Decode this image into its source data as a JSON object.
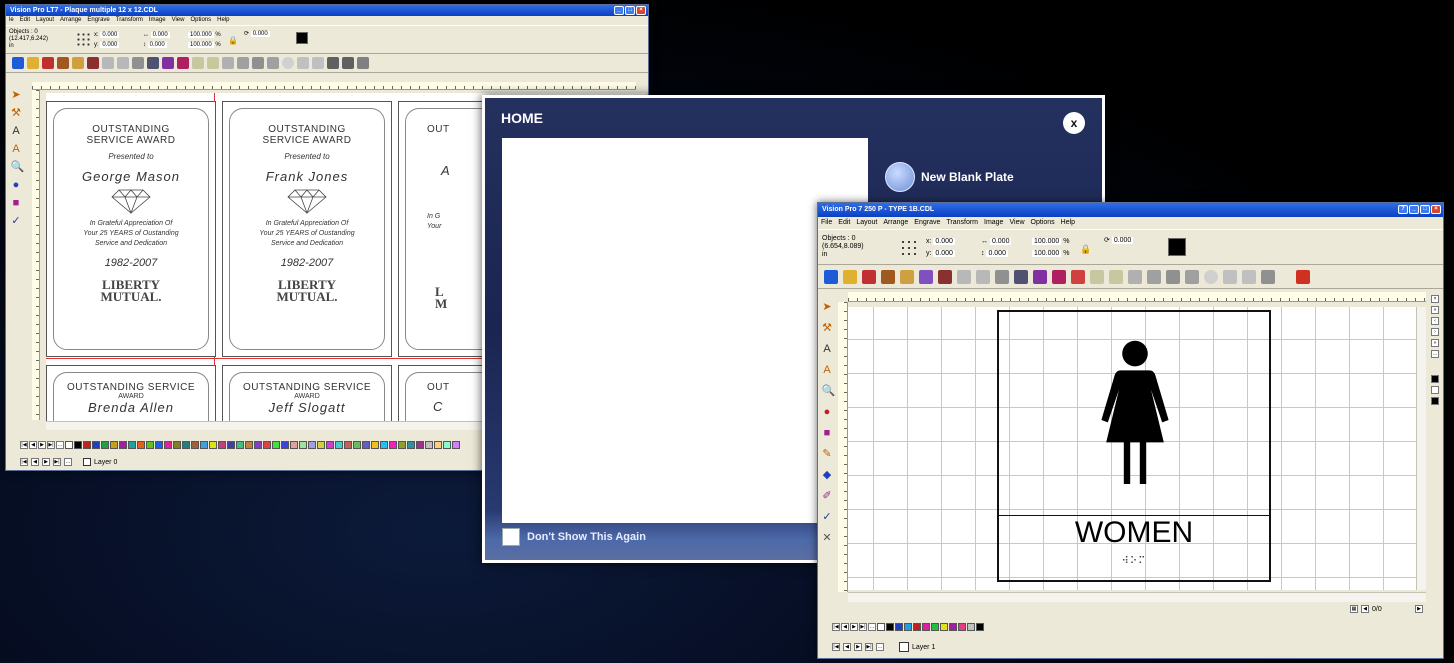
{
  "window1": {
    "title": "Vision Pro LT7 - Plaque multiple 12 x 12.CDL",
    "menu": [
      "le",
      "Edit",
      "Layout",
      "Arrange",
      "Engrave",
      "Transform",
      "Image",
      "View",
      "Options",
      "Help"
    ],
    "objects_label": "Objects : 0",
    "coords": "(12.417,6.242)",
    "unit": "in",
    "x_label": "x:",
    "x_val": "0.000",
    "y_label": "y:",
    "y_val": "0.000",
    "w_val": "0.000",
    "h_val": "0.000",
    "sx_val": "100.000",
    "sy_val": "100.000",
    "rot_val": "0.000",
    "layer_label": "Layer 0",
    "plaques": [
      {
        "title": "OUTSTANDING SERVICE AWARD",
        "presented": "Presented to",
        "name": "George Mason",
        "body1": "In Grateful Appreciation Of",
        "body2": "Your 25 YEARS of Oustanding",
        "body3": "Service and Dedication",
        "years": "1982-2007",
        "logo1": "LIBERTY",
        "logo2": "MUTUAL."
      },
      {
        "title": "OUTSTANDING SERVICE AWARD",
        "presented": "Presented to",
        "name": "Frank Jones",
        "body1": "In Grateful Appreciation Of",
        "body2": "Your 25 YEARS of Oustanding",
        "body3": "Service and Dedication",
        "years": "1982-2007",
        "logo1": "LIBERTY",
        "logo2": "MUTUAL."
      },
      {
        "title": "OUT",
        "name": "A",
        "body1": "In G",
        "body2": "Your",
        "logo1": "L",
        "logo2": "M"
      },
      {
        "title": "OUTSTANDING SERVICE",
        "sub": "AWARD",
        "name": "Brenda Allen"
      },
      {
        "title": "OUTSTANDING SERVICE",
        "sub": "AWARD",
        "name": "Jeff Slogatt"
      },
      {
        "title": "OUT",
        "name": "C"
      }
    ]
  },
  "home": {
    "title": "HOME",
    "close": "x",
    "new_plate": "New Blank Plate",
    "dont_show": "Don't Show This Again"
  },
  "window2": {
    "title": "Vision Pro 7 250 P - TYPE 1B.CDL",
    "menu": [
      "File",
      "Edit",
      "Layout",
      "Arrange",
      "Engrave",
      "Transform",
      "Image",
      "View",
      "Options",
      "Help"
    ],
    "objects_label": "Objects : 0",
    "coords": "(6.654,8.089)",
    "unit": "in",
    "x_label": "x:",
    "x_val": "0.000",
    "y_label": "y:",
    "y_val": "0.000",
    "w_val": "0.000",
    "h_val": "0.000",
    "sx_val": "100.000",
    "sy_val": "100.000",
    "rot_val": "0.000",
    "sign_text": "WOMEN",
    "braille": "⠺⠕⠍",
    "page_counter": "0/0",
    "layer_label": "Layer 1"
  },
  "colors": {
    "titlebar": "#0a3fc2",
    "window_bg": "#ece9d8",
    "home_bg": "#1a2550"
  }
}
